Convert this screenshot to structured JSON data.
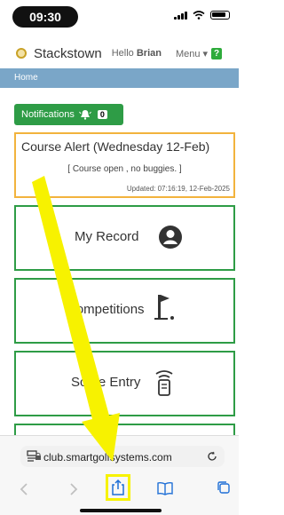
{
  "status_bar": {
    "time": "09:30"
  },
  "header": {
    "club_name": "Stackstown",
    "hello_prefix": "Hello",
    "user_name": "Brian",
    "menu_label": "Menu ▾",
    "help_label": "?"
  },
  "breadcrumb": {
    "home": "Home"
  },
  "notifications": {
    "label": "Notifications",
    "count": "0"
  },
  "alert": {
    "title": "Course Alert (Wednesday 12-Feb)",
    "message": "[ Course open , no buggies. ]",
    "updated": "Updated: 07:16:19, 12-Feb-2025"
  },
  "tiles": [
    {
      "label": "My Record",
      "icon": "user-icon"
    },
    {
      "label": "Competitions",
      "icon": "golf-flag-icon"
    },
    {
      "label": "Score Entry",
      "icon": "scorecard-icon"
    }
  ],
  "browser": {
    "url": "club.smartgolfsystems.com"
  },
  "colors": {
    "accent_green": "#2e9c46",
    "alert_border": "#f2b33d",
    "breadcrumb_bg": "#7aa6c8",
    "annotation_yellow": "#f7f200"
  }
}
